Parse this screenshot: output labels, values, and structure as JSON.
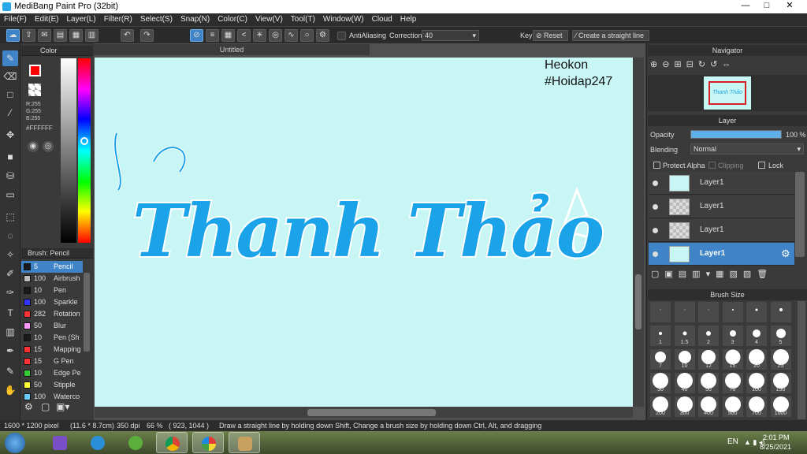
{
  "window": {
    "title": "MediBang Paint Pro (32bit)",
    "controls": [
      "—",
      "□",
      "✕"
    ]
  },
  "menu": [
    "File(F)",
    "Edit(E)",
    "Layer(L)",
    "Filter(R)",
    "Select(S)",
    "Snap(N)",
    "Color(C)",
    "View(V)",
    "Tool(T)",
    "Window(W)",
    "Cloud",
    "Help"
  ],
  "toolbar": {
    "antialiasing_label": "AntiAliasing",
    "correction_label": "Correction",
    "correction_value": "40",
    "key_label": "Key",
    "reset_label": "Reset",
    "straight_line_placeholder": "Create a straight line"
  },
  "color_panel": {
    "title": "Color",
    "r": "R:255",
    "g": "G:255",
    "b": "B:255",
    "hex": "#FFFFFF",
    "primary": "#ff0000",
    "secondary": "#000000"
  },
  "brush_panel": {
    "title": "Brush: Pencil",
    "items": [
      {
        "size": "5",
        "name": "Pencil",
        "color": "#1a1a1a",
        "selected": true
      },
      {
        "size": "100",
        "name": "Airbrush",
        "color": "#bfbfbf"
      },
      {
        "size": "10",
        "name": "Pen",
        "color": "#1a1a1a"
      },
      {
        "size": "100",
        "name": "Sparkle",
        "color": "#3333ff"
      },
      {
        "size": "282",
        "name": "Rotation",
        "color": "#ff3333"
      },
      {
        "size": "50",
        "name": "Blur",
        "color": "#ff99ff"
      },
      {
        "size": "10",
        "name": "Pen (Sh",
        "color": "#1a1a1a"
      },
      {
        "size": "15",
        "name": "Mapping",
        "color": "#ff3333"
      },
      {
        "size": "15",
        "name": "G Pen",
        "color": "#ff3333"
      },
      {
        "size": "10",
        "name": "Edge Pe",
        "color": "#33cc33"
      },
      {
        "size": "50",
        "name": "Stipple",
        "color": "#ffff33"
      },
      {
        "size": "100",
        "name": "Waterco",
        "color": "#66ccff"
      }
    ]
  },
  "document": {
    "tab": "Untitled",
    "canvas_color": "#c8f6f4",
    "watermark_line1": "Heokon",
    "watermark_line2": "#Hoidap247",
    "artwork_text": "Thanh Thảo",
    "artwork_color": "#1aa3e8"
  },
  "navigator": {
    "title": "Navigator",
    "thumb_text": "Thanh Thảo"
  },
  "layer_panel": {
    "title": "Layer",
    "opacity_label": "Opacity",
    "opacity_value": "100 %",
    "opacity": 1.0,
    "blending_label": "Blending",
    "blending_value": "Normal",
    "protect_alpha": "Protect Alpha",
    "clipping": "Clipping",
    "lock": "Lock",
    "layers": [
      {
        "name": "Layer1",
        "selected": false
      },
      {
        "name": "Layer1",
        "selected": false
      },
      {
        "name": "Layer1",
        "selected": false
      },
      {
        "name": "Layer1",
        "selected": true
      }
    ]
  },
  "brush_size_panel": {
    "title": "Brush Size",
    "sizes": [
      "",
      "",
      "",
      "",
      "",
      "",
      "1",
      "1.5",
      "2",
      "3",
      "4",
      "5",
      "7",
      "10",
      "12",
      "15",
      "20",
      "25",
      "30",
      "40",
      "50",
      "70",
      "100",
      "150",
      "200",
      "300",
      "400",
      "500",
      "700",
      "1000"
    ]
  },
  "status": {
    "dimensions": "1600 * 1200 pixel",
    "physical": "(11.6 * 8.7cm)",
    "dpi": "350 dpi",
    "zoom": "66 %",
    "coords": "( 923, 1044 )",
    "hint": "Draw a straight line by holding down Shift, Change a brush size by holding down Ctrl, Alt, and dragging"
  },
  "taskbar": {
    "lang": "EN",
    "time": "2:01 PM",
    "date": "8/25/2021"
  }
}
